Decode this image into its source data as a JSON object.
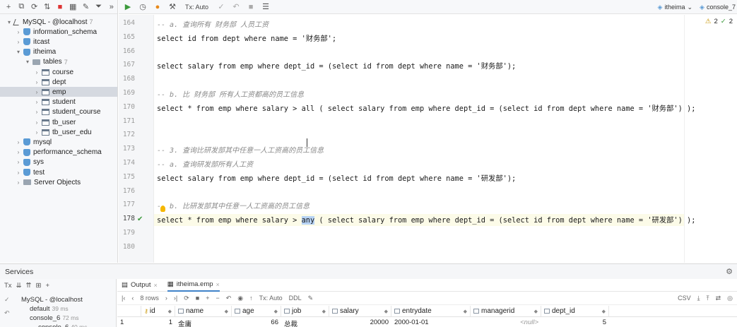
{
  "editor": {
    "tx_mode": "Tx: Auto",
    "tabs": [
      {
        "label": "itheima"
      },
      {
        "label": "console_7"
      }
    ],
    "inspections": {
      "warnings": "2",
      "ok": "2"
    },
    "lines": [
      {
        "num": "164",
        "parts": [
          {
            "t": "-- a. 查询所有 财务部 人员工资",
            "c": "comment"
          }
        ]
      },
      {
        "num": "165",
        "parts": [
          {
            "t": "select id from dept where name = '财务部';",
            "c": "code"
          }
        ]
      },
      {
        "num": "166",
        "parts": [
          {
            "t": "",
            "c": "code"
          }
        ]
      },
      {
        "num": "167",
        "parts": [
          {
            "t": "select salary from emp where dept_id = (select id from dept where name = '财务部');",
            "c": "code"
          }
        ]
      },
      {
        "num": "168",
        "parts": [
          {
            "t": "",
            "c": "code"
          }
        ]
      },
      {
        "num": "169",
        "parts": [
          {
            "t": "-- b. 比 财务部 所有人工资都高的员工信息",
            "c": "comment"
          }
        ]
      },
      {
        "num": "170",
        "parts": [
          {
            "t": "select * from emp where salary > all ( select salary from emp where dept_id = (select id from dept where name = '财务部') );",
            "c": "code"
          }
        ]
      },
      {
        "num": "171",
        "parts": [
          {
            "t": "",
            "c": "code"
          }
        ]
      },
      {
        "num": "172",
        "parts": [
          {
            "t": "",
            "c": "code"
          }
        ]
      },
      {
        "num": "173",
        "parts": [
          {
            "t": "-- 3. 查询比研发部其中任意一人工资高的员工信息",
            "c": "comment"
          }
        ]
      },
      {
        "num": "174",
        "parts": [
          {
            "t": "-- a. 查询研发部所有人工资",
            "c": "comment"
          }
        ]
      },
      {
        "num": "175",
        "parts": [
          {
            "t": "select salary from emp where dept_id = (select id from dept where name = '研发部');",
            "c": "code"
          }
        ]
      },
      {
        "num": "176",
        "parts": [
          {
            "t": "",
            "c": "code"
          }
        ]
      },
      {
        "num": "177",
        "parts": [
          {
            "t": "-- b. 比研发部其中任意一人工资高的员工信息",
            "c": "comment"
          }
        ]
      },
      {
        "num": "178",
        "parts": [
          {
            "t": "select * from emp where salary > ",
            "c": "code"
          },
          {
            "t": "any",
            "c": "hl"
          },
          {
            "t": " ( select salary from emp where dept_id = (select id from dept where name = '研发部') );",
            "c": "code"
          }
        ]
      },
      {
        "num": "179",
        "parts": [
          {
            "t": "",
            "c": "code"
          }
        ]
      },
      {
        "num": "180",
        "parts": [
          {
            "t": "",
            "c": "code"
          }
        ]
      }
    ]
  },
  "tree": [
    {
      "label": "MySQL - @localhost",
      "count": "7",
      "depth": 0,
      "arrow": "▾",
      "icon": "server"
    },
    {
      "label": "information_schema",
      "count": "",
      "depth": 1,
      "arrow": "›",
      "icon": "db"
    },
    {
      "label": "itcast",
      "count": "",
      "depth": 1,
      "arrow": "›",
      "icon": "db"
    },
    {
      "label": "itheima",
      "count": "",
      "depth": 1,
      "arrow": "▾",
      "icon": "db"
    },
    {
      "label": "tables",
      "count": "7",
      "depth": 2,
      "arrow": "▾",
      "icon": "folder"
    },
    {
      "label": "course",
      "count": "",
      "depth": 3,
      "arrow": "›",
      "icon": "tbl"
    },
    {
      "label": "dept",
      "count": "",
      "depth": 3,
      "arrow": "›",
      "icon": "tbl"
    },
    {
      "label": "emp",
      "count": "",
      "depth": 3,
      "arrow": "›",
      "icon": "tbl",
      "selected": true
    },
    {
      "label": "student",
      "count": "",
      "depth": 3,
      "arrow": "›",
      "icon": "tbl"
    },
    {
      "label": "student_course",
      "count": "",
      "depth": 3,
      "arrow": "›",
      "icon": "tbl"
    },
    {
      "label": "tb_user",
      "count": "",
      "depth": 3,
      "arrow": "›",
      "icon": "tbl"
    },
    {
      "label": "tb_user_edu",
      "count": "",
      "depth": 3,
      "arrow": "›",
      "icon": "tbl"
    },
    {
      "label": "mysql",
      "count": "",
      "depth": 1,
      "arrow": "›",
      "icon": "db"
    },
    {
      "label": "performance_schema",
      "count": "",
      "depth": 1,
      "arrow": "›",
      "icon": "db"
    },
    {
      "label": "sys",
      "count": "",
      "depth": 1,
      "arrow": "›",
      "icon": "db"
    },
    {
      "label": "test",
      "count": "",
      "depth": 1,
      "arrow": "›",
      "icon": "db"
    },
    {
      "label": "Server Objects",
      "count": "",
      "depth": 1,
      "arrow": "›",
      "icon": "folder"
    }
  ],
  "services": {
    "title": "Services",
    "toolbar_tx": "Tx",
    "tree": [
      {
        "label": "MySQL - @localhost",
        "time": "",
        "depth": 0
      },
      {
        "label": "default",
        "time": "39 ms",
        "depth": 1
      },
      {
        "label": "console_6",
        "time": "72 ms",
        "depth": 1
      },
      {
        "label": "console_6",
        "time": "40 ms",
        "depth": 2
      }
    ]
  },
  "results": {
    "tabs": [
      {
        "label": "Output"
      },
      {
        "label": "itheima.emp"
      }
    ],
    "rows_label": "8 rows",
    "tx_mode": "Tx: Auto",
    "ddl_label": "DDL",
    "csv_label": "CSV",
    "columns": [
      {
        "name": "id",
        "key": true
      },
      {
        "name": "name",
        "key": false
      },
      {
        "name": "age",
        "key": false
      },
      {
        "name": "job",
        "key": false
      },
      {
        "name": "salary",
        "key": false
      },
      {
        "name": "entrydate",
        "key": false
      },
      {
        "name": "managerid",
        "key": false
      },
      {
        "name": "dept_id",
        "key": false
      }
    ],
    "row": {
      "rownum": "1",
      "id": "1",
      "name": "金庸",
      "age": "66",
      "job": "总裁",
      "salary": "20000",
      "entrydate": "2000-01-01",
      "managerid": "<null>",
      "dept_id": "5"
    }
  }
}
